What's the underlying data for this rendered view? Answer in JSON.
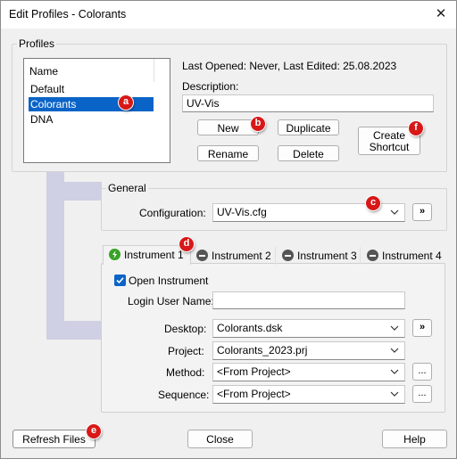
{
  "window": {
    "title": "Edit Profiles - Colorants",
    "close_glyph": "✕"
  },
  "profiles": {
    "group_label": "Profiles",
    "list_header": "Name",
    "items": [
      "Default",
      "Colorants",
      "DNA"
    ],
    "selected_index": 1,
    "last_info": "Last Opened: Never, Last Edited: 25.08.2023",
    "description_label": "Description:",
    "description_value": "UV-Vis",
    "buttons": {
      "new": "New",
      "duplicate": "Duplicate",
      "rename": "Rename",
      "delete": "Delete",
      "create_shortcut_line1": "Create",
      "create_shortcut_line2": "Shortcut"
    }
  },
  "general": {
    "group_label": "General",
    "configuration_label": "Configuration:",
    "configuration_value": "UV-Vis.cfg",
    "more_glyph": "»"
  },
  "instruments": {
    "tabs": [
      {
        "label": "Instrument 1",
        "status": "connected"
      },
      {
        "label": "Instrument 2",
        "status": "disabled"
      },
      {
        "label": "Instrument 3",
        "status": "disabled"
      },
      {
        "label": "Instrument 4",
        "status": "disabled"
      }
    ],
    "active_tab": 0,
    "open_instrument_label": "Open Instrument",
    "open_instrument_checked": true,
    "login_label": "Login User Name:",
    "login_value": "",
    "desktop_label": "Desktop:",
    "desktop_value": "Colorants.dsk",
    "project_label": "Project:",
    "project_value": "Colorants_2023.prj",
    "method_label": "Method:",
    "method_value": "<From Project>",
    "sequence_label": "Sequence:",
    "sequence_value": "<From Project>",
    "browse_glyph": "...",
    "more_glyph": "»"
  },
  "footer": {
    "refresh": "Refresh Files",
    "close": "Close",
    "help": "Help"
  },
  "badges": {
    "a": "a",
    "b": "b",
    "c": "c",
    "d": "d",
    "e": "e",
    "f": "f"
  },
  "colors": {
    "selection": "#0a64c8",
    "badge": "#d81818",
    "connected": "#38a325",
    "disabled": "#555555",
    "decoration": "#cfd0e3"
  }
}
